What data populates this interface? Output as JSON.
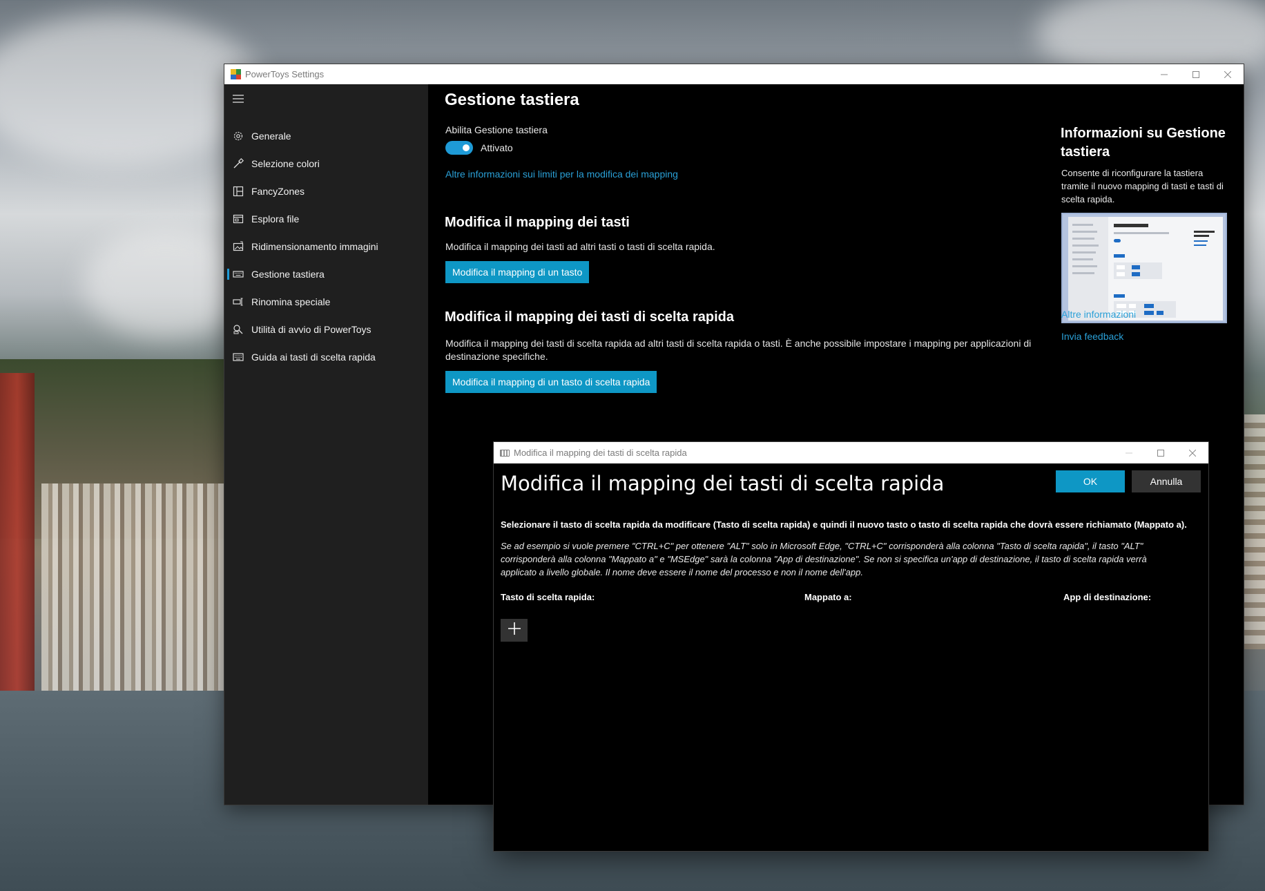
{
  "main_window": {
    "title": "PowerToys Settings",
    "sidebar": {
      "items": [
        {
          "label": "Generale",
          "icon": "gear-icon"
        },
        {
          "label": "Selezione colori",
          "icon": "eyedropper-icon"
        },
        {
          "label": "FancyZones",
          "icon": "zones-icon"
        },
        {
          "label": "Esplora file",
          "icon": "file-explorer-icon"
        },
        {
          "label": "Ridimensionamento immagini",
          "icon": "image-resize-icon"
        },
        {
          "label": "Gestione tastiera",
          "icon": "keyboard-icon",
          "selected": true
        },
        {
          "label": "Rinomina speciale",
          "icon": "rename-icon"
        },
        {
          "label": "Utilità di avvio di PowerToys",
          "icon": "launcher-icon"
        },
        {
          "label": "Guida ai tasti di scelta rapida",
          "icon": "shortcut-guide-icon"
        }
      ]
    },
    "content": {
      "page_title": "Gestione tastiera",
      "enable_label": "Abilita Gestione tastiera",
      "toggle_state": "Attivato",
      "limits_link": "Altre informazioni sui limiti per la modifica dei mapping",
      "keys_section": {
        "title": "Modifica il mapping dei tasti",
        "description": "Modifica il mapping dei tasti ad altri tasti o tasti di scelta rapida.",
        "button": "Modifica il mapping di un tasto"
      },
      "shortcuts_section": {
        "title": "Modifica il mapping dei tasti di scelta rapida",
        "description": "Modifica il mapping dei tasti di scelta rapida ad altri tasti di scelta rapida o tasti. È anche possibile impostare i mapping per applicazioni di destinazione specifiche.",
        "button": "Modifica il mapping di un tasto di scelta rapida"
      },
      "about": {
        "title": "Informazioni su Gestione tastiera",
        "description": "Consente di riconfigurare la tastiera tramite il nuovo mapping di tasti e tasti di scelta rapida.",
        "more_info_link": "Altre informazioni",
        "feedback_link": "Invia feedback"
      }
    }
  },
  "dialog": {
    "window_title": "Modifica il mapping dei tasti di scelta rapida",
    "heading": "Modifica il mapping dei tasti di scelta rapida",
    "ok_label": "OK",
    "cancel_label": "Annulla",
    "instructions": "Selezionare il tasto di scelta rapida da modificare (Tasto di scelta rapida) e quindi il nuovo tasto o tasto di scelta rapida che dovrà essere richiamato (Mappato a).",
    "example": "Se ad esempio si vuole premere \"CTRL+C\" per ottenere \"ALT\" solo in Microsoft Edge, \"CTRL+C\" corrisponderà alla colonna \"Tasto di scelta rapida\", il tasto \"ALT\" corrisponderà alla colonna \"Mappato a\" e \"MSEdge\" sarà la colonna \"App di destinazione\". Se non si specifica un'app di destinazione, il tasto di scelta rapida verrà applicato a livello globale. Il nome deve essere il nome del processo e non il nome dell'app.",
    "columns": [
      "Tasto di scelta rapida:",
      "Mappato a:",
      "App di destinazione:"
    ],
    "add_icon": "plus-icon"
  },
  "colors": {
    "accent": "#0e97c5",
    "link": "#2aa0d7",
    "sidebar_bg": "#1f1f1f",
    "content_bg": "#000000"
  }
}
